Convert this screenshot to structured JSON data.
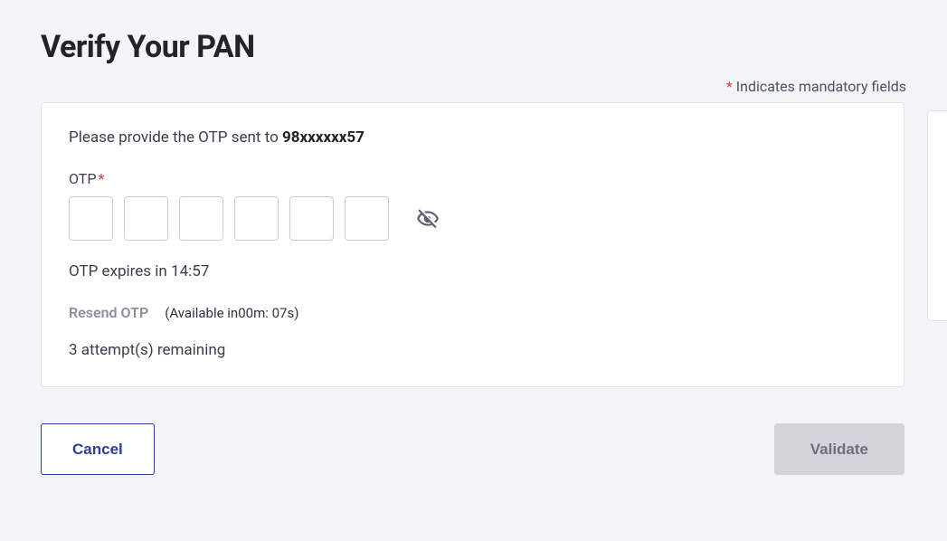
{
  "title": "Verify Your PAN",
  "mandatory_note": "Indicates mandatory fields",
  "card": {
    "prompt_prefix": "Please provide the OTP sent to ",
    "phone_masked": "98xxxxxx57",
    "otp_label": "OTP",
    "otp_count": 6,
    "expires_prefix": "OTP expires in ",
    "expires_time": "14:57",
    "resend_label": "Resend OTP",
    "resend_avail_prefix": "(Available in",
    "resend_avail_time": "00m: 07s",
    "resend_avail_suffix": ")",
    "attempts_text": "3 attempt(s) remaining"
  },
  "actions": {
    "cancel": "Cancel",
    "validate": "Validate"
  }
}
